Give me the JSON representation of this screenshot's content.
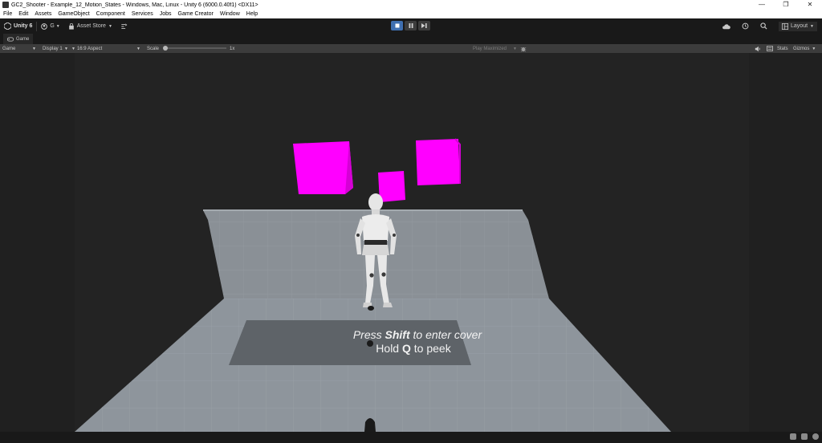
{
  "window": {
    "title": "GC2_Shooter - Example_12_Motion_States - Windows, Mac, Linux - Unity 6 (6000.0.40f1) <DX11>"
  },
  "menu": [
    "File",
    "Edit",
    "Assets",
    "GameObject",
    "Component",
    "Services",
    "Jobs",
    "Game Creator",
    "Window",
    "Help"
  ],
  "toolbar": {
    "unity_label": "Unity 6",
    "account_label": "G",
    "asset_store_label": "Asset Store",
    "layout_label": "Layout"
  },
  "tab": {
    "label": "Game"
  },
  "gamebar": {
    "view_select": "Game",
    "display_select": "Display 1",
    "aspect_select": "16:9 Aspect",
    "scale_label": "Scale",
    "scale_value": "1x",
    "play_mode_select": "Play Maximized",
    "stats_label": "Stats",
    "gizmos_label": "Gizmos"
  },
  "scene": {
    "hint_line1_pre": "Press ",
    "hint_line1_key": "Shift",
    "hint_line1_post": " to enter cover",
    "hint_line2_pre": "Hold ",
    "hint_line2_key": "Q",
    "hint_line2_post": " to peek"
  },
  "colors": {
    "cube": "#ff00ff",
    "floor": "#8e959c",
    "wall": "#8a9096",
    "play_active": "#3f6fb0"
  }
}
